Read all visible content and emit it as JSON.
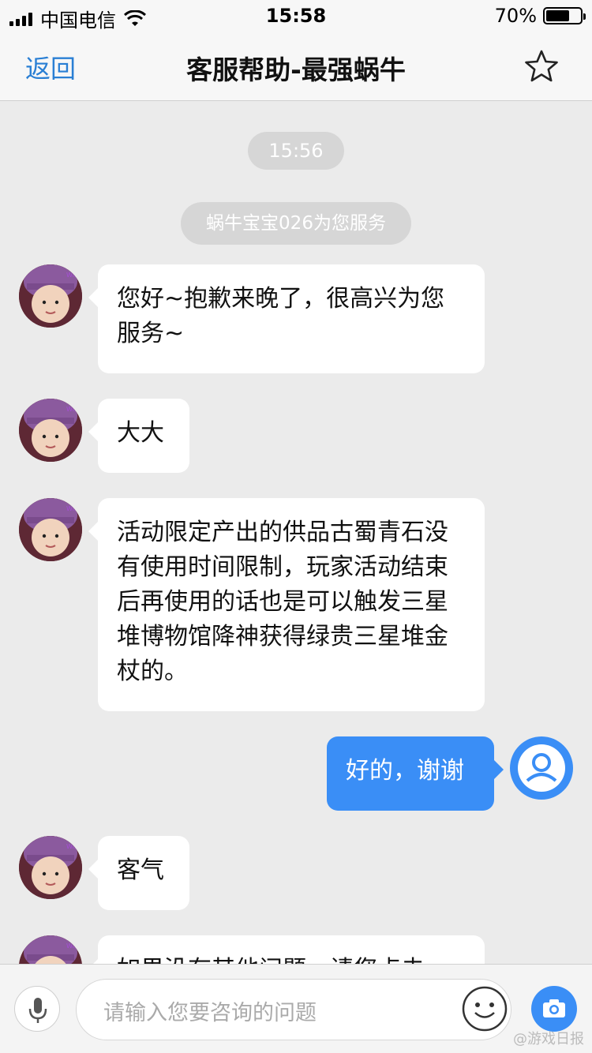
{
  "status_bar": {
    "carrier": "中国电信",
    "time": "15:58",
    "battery_percent": "70%",
    "battery_level": 0.7
  },
  "nav": {
    "back_label": "返回",
    "title": "客服帮助-最强蜗牛",
    "favorite_icon": "star-outline-icon"
  },
  "chat": {
    "timestamp": "15:56",
    "system_notice": "蜗牛宝宝026为您服务",
    "messages": [
      {
        "from": "agent",
        "text": "您好~抱歉来晚了，很高兴为您服务~"
      },
      {
        "from": "agent",
        "text": "大大"
      },
      {
        "from": "agent",
        "text": "活动限定产出的供品古蜀青石没有使用时间限制，玩家活动结束后再使用的话也是可以触发三星堆博物馆降神获得绿贵三星堆金杖的。"
      },
      {
        "from": "user",
        "text": "好的，谢谢"
      },
      {
        "from": "agent",
        "text": "客气"
      },
      {
        "from": "agent",
        "text": "如果没有其他问题，请您点击"
      }
    ]
  },
  "input_bar": {
    "placeholder": "请输入您要咨询的问题",
    "mic_icon": "microphone-icon",
    "emoji_icon": "emoji-icon",
    "camera_icon": "camera-icon"
  },
  "watermark": "@游戏日报"
}
